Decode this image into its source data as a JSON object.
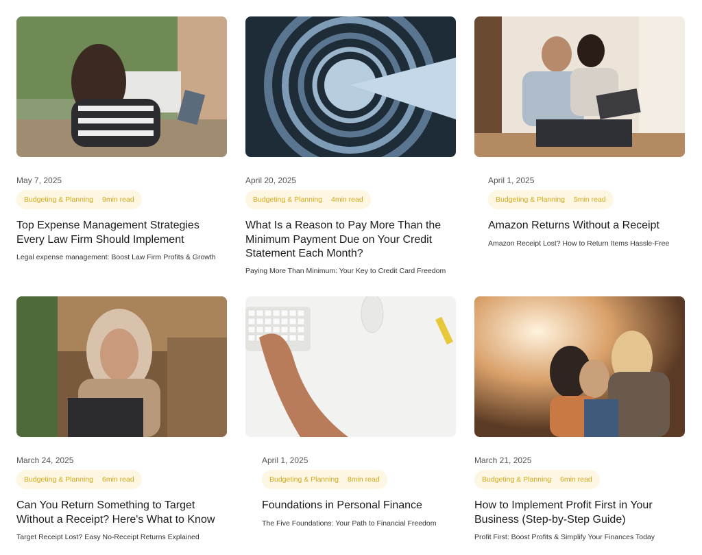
{
  "posts": [
    {
      "date": "May 7, 2025",
      "category": "Budgeting & Planning",
      "read_time": "9min read",
      "title": "Top Expense Management Strategies Every Law Firm Should Implement",
      "subtitle": "Legal expense management: Boost Law Firm Profits & Growth"
    },
    {
      "date": "April 20, 2025",
      "category": "Budgeting & Planning",
      "read_time": "4min read",
      "title": "What Is a Reason to Pay More Than the Minimum Payment Due on Your Credit Statement Each Month?",
      "subtitle": "Paying More Than Minimum: Your Key to Credit Card Freedom"
    },
    {
      "date": "April 1, 2025",
      "category": "Budgeting & Planning",
      "read_time": "5min read",
      "title": "Amazon Returns Without a Receipt",
      "subtitle": "Amazon Receipt Lost? How to Return Items Hassle-Free"
    },
    {
      "date": "March 24, 2025",
      "category": "Budgeting & Planning",
      "read_time": "6min read",
      "title": "Can You Return Something to Target Without a Receipt? Here's What to Know",
      "subtitle": "Target Receipt Lost? Easy No-Receipt Returns Explained"
    },
    {
      "date": "April 1, 2025",
      "category": "Budgeting & Planning",
      "read_time": "8min read",
      "title": "Foundations in Personal Finance",
      "subtitle": "The Five Foundations: Your Path to Financial Freedom"
    },
    {
      "date": "March 21, 2025",
      "category": "Budgeting & Planning",
      "read_time": "6min read",
      "title": "How to Implement Profit First in Your Business (Step-by-Step Guide)",
      "subtitle": "Profit First: Boost Profits & Simplify Your Finances Today"
    }
  ],
  "colors": {
    "tag_text": "#d1a91a",
    "tag_bg": "#fdf6e3"
  }
}
